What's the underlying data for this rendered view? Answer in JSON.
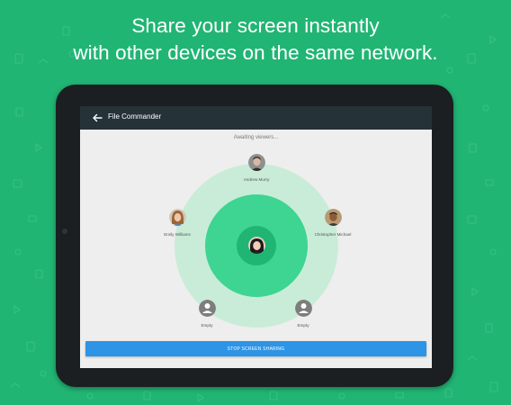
{
  "headline": {
    "line1": "Share your screen instantly",
    "line2": "with other devices on the same network."
  },
  "colors": {
    "background": "#21b574",
    "appbar": "#253238",
    "ring_outer": "#c9ecd8",
    "ring_middle": "#3ed492",
    "ring_inner": "#21b574",
    "button": "#2d94e6"
  },
  "appbar": {
    "title": "File Commander",
    "back_icon": "arrow-left-icon"
  },
  "status_text": "Awaiting viewers...",
  "viewers": [
    {
      "name": "Andrew Murry",
      "icon": "avatar-photo"
    },
    {
      "name": "Emily Williams",
      "icon": "avatar-photo"
    },
    {
      "name": "Christopher Michael",
      "icon": "avatar-photo"
    },
    {
      "name": "Empty",
      "icon": "person-placeholder-icon"
    },
    {
      "name": "Empty",
      "icon": "person-placeholder-icon"
    }
  ],
  "host": {
    "icon": "avatar-photo"
  },
  "stop_button": "STOP SCREEN SHARING"
}
